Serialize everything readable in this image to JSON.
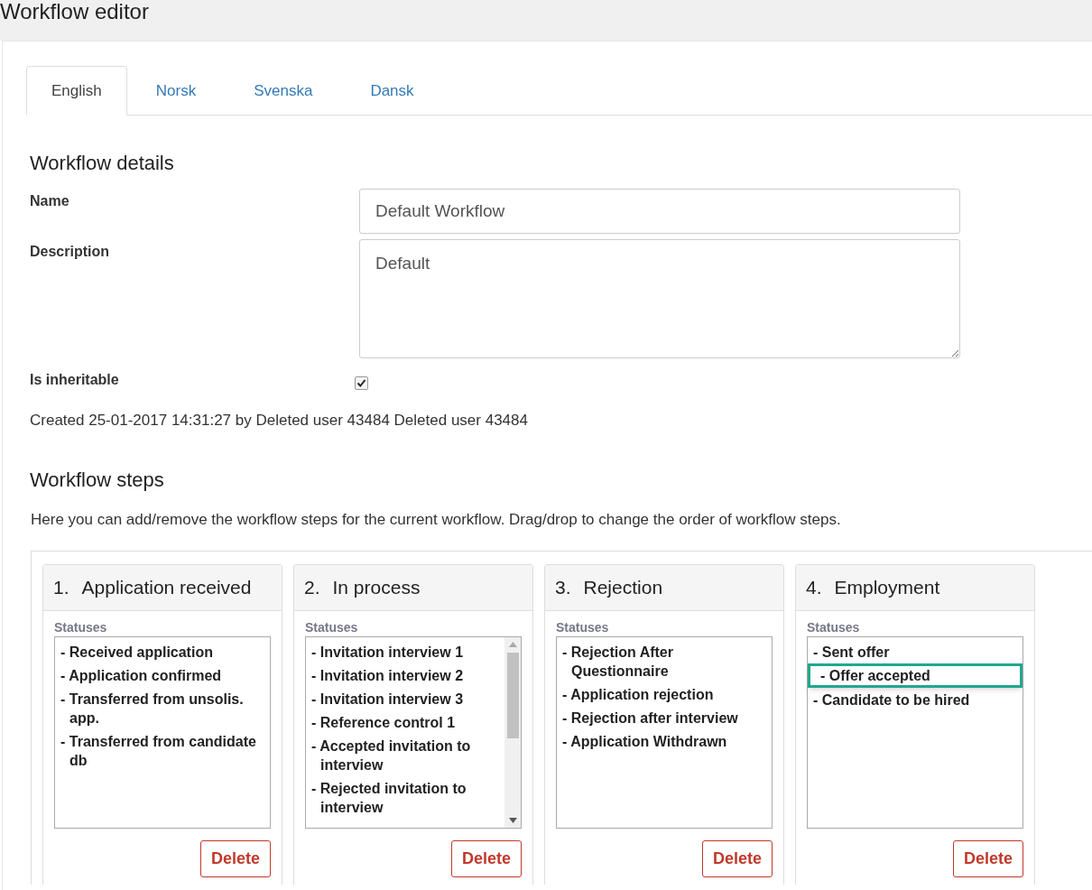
{
  "page_title": "Workflow editor",
  "tabs": [
    {
      "label": "English",
      "selected": true
    },
    {
      "label": "Norsk",
      "selected": false
    },
    {
      "label": "Svenska",
      "selected": false
    },
    {
      "label": "Dansk",
      "selected": false
    }
  ],
  "details": {
    "heading": "Workflow details",
    "name": {
      "label": "Name",
      "value": "Default Workflow"
    },
    "description": {
      "label": "Description",
      "value": "Default"
    },
    "inheritable": {
      "label": "Is inheritable",
      "checked": true
    },
    "created": "Created 25-01-2017 14:31:27 by Deleted user 43484 Deleted user 43484"
  },
  "steps_section": {
    "heading": "Workflow steps",
    "hint": "Here you can add/remove the workflow steps for the current workflow. Drag/drop to change the order of workflow steps.",
    "steps": [
      {
        "number": "1.",
        "title": "Application received",
        "statuses_label": "Statuses",
        "scrollable": false,
        "delete": "Delete",
        "statuses": [
          {
            "text": "- Received application",
            "selected": false
          },
          {
            "text": "- Application confirmed",
            "selected": false
          },
          {
            "text": "- Transferred from unsolis. app.",
            "selected": false
          },
          {
            "text": "- Transferred from candidate db",
            "selected": false
          }
        ]
      },
      {
        "number": "2.",
        "title": "In process",
        "statuses_label": "Statuses",
        "scrollable": true,
        "delete": "Delete",
        "statuses": [
          {
            "text": "- Invitation interview 1",
            "selected": false
          },
          {
            "text": "- Invitation interview 2",
            "selected": false
          },
          {
            "text": "- Invitation interview 3",
            "selected": false
          },
          {
            "text": "- Reference control 1",
            "selected": false
          },
          {
            "text": "- Accepted invitation to interview",
            "selected": false
          },
          {
            "text": "- Rejected invitation to interview",
            "selected": false
          }
        ]
      },
      {
        "number": "3.",
        "title": "Rejection",
        "statuses_label": "Statuses",
        "scrollable": false,
        "delete": "Delete",
        "statuses": [
          {
            "text": "- Rejection After Questionnaire",
            "selected": false
          },
          {
            "text": "- Application rejection",
            "selected": false
          },
          {
            "text": "- Rejection after interview",
            "selected": false
          },
          {
            "text": "- Application Withdrawn",
            "selected": false
          }
        ]
      },
      {
        "number": "4.",
        "title": "Employment",
        "statuses_label": "Statuses",
        "scrollable": false,
        "delete": "Delete",
        "statuses": [
          {
            "text": "- Sent offer",
            "selected": false
          },
          {
            "text": "- Offer accepted",
            "selected": true
          },
          {
            "text": "- Candidate to be hired",
            "selected": false
          }
        ]
      }
    ]
  }
}
